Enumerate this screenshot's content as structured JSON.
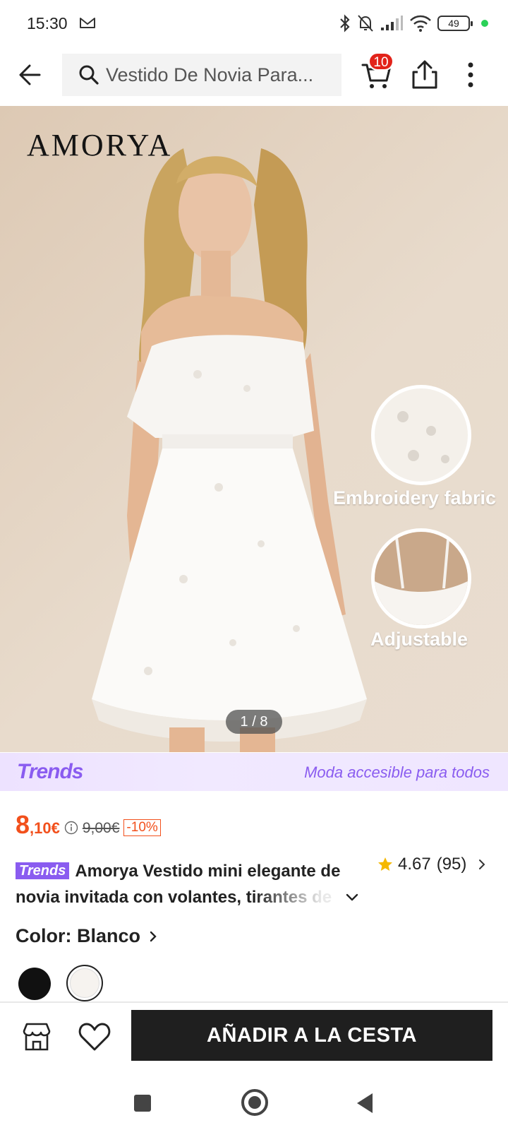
{
  "status_bar": {
    "time": "15:30",
    "battery": "49",
    "mail_icon": "gmail-icon",
    "icons": [
      "bluetooth-icon",
      "mute-icon",
      "signal-icon",
      "wifi-icon",
      "battery-icon"
    ]
  },
  "nav": {
    "search_placeholder": "Vestido De Novia Para...",
    "cart_count": "10"
  },
  "hero": {
    "brand": "AMORYA",
    "feature_1": "Embroidery fabric",
    "feature_2": "Adjustable",
    "image_counter": "1 / 8"
  },
  "trends": {
    "logo": "Trends",
    "slogan": "Moda accesible para todos"
  },
  "price": {
    "current_int": "8",
    "current_dec": ",10€",
    "original": "9,00€",
    "discount": "-10%"
  },
  "product": {
    "tag": "Trends",
    "title": "Amorya Vestido mini elegante de novia invitada con volantes, tirantes de",
    "rating": "4.67",
    "reviews": "(95)"
  },
  "color": {
    "label": "Color: Blanco",
    "options": [
      "Negro",
      "Blanco"
    ],
    "selected": "Blanco"
  },
  "actions": {
    "add_to_cart": "AÑADIR A LA CESTA"
  },
  "colors": {
    "accent": "#f2501c",
    "trends_purple": "#8a5cf0",
    "cta_bg": "#1f1f1f",
    "badge_red": "#e2231a"
  }
}
